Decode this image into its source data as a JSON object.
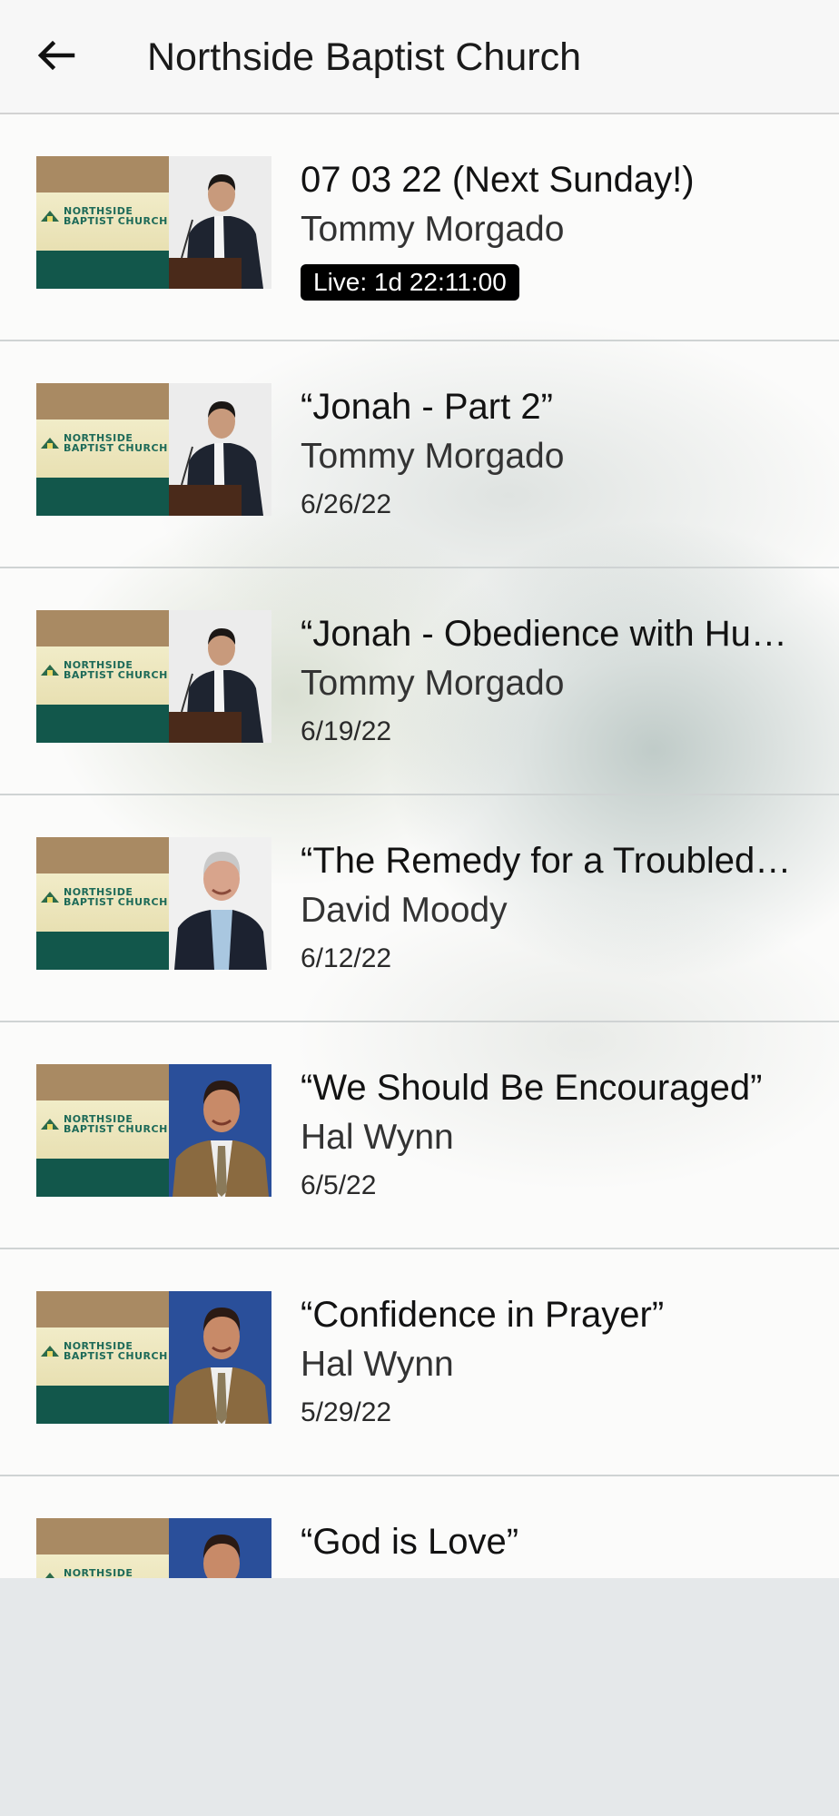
{
  "header": {
    "back_icon": "arrow-left-icon",
    "title": "Northside Baptist Church"
  },
  "thumbnail_logo": {
    "line1": "NORTHSIDE",
    "line2": "BAPTIST CHURCH"
  },
  "colors": {
    "header_bg": "#f7f7f7",
    "logo_tan": "#a98a63",
    "logo_cream": "#f1ecc8",
    "logo_green": "#12574b",
    "badge_bg": "#000000",
    "list_bg": "#fbfbfa",
    "footer_bg": "#e5e8ea"
  },
  "sermons": [
    {
      "title": "07 03 22 (Next Sunday!)",
      "speaker": "Tommy Morgado",
      "live_badge": "Live: 1d 22:11:00",
      "photo": "tommy"
    },
    {
      "title": "“Jonah - Part 2”",
      "speaker": "Tommy Morgado",
      "date": "6/26/22",
      "photo": "tommy"
    },
    {
      "title": "“Jonah - Obedience with Hu…",
      "speaker": "Tommy Morgado",
      "date": "6/19/22",
      "photo": "tommy"
    },
    {
      "title": "“The Remedy for a Troubled…",
      "speaker": "David Moody",
      "date": "6/12/22",
      "photo": "david"
    },
    {
      "title": "“We Should Be Encouraged”",
      "speaker": "Hal Wynn",
      "date": "6/5/22",
      "photo": "hal"
    },
    {
      "title": "“Confidence in Prayer”",
      "speaker": "Hal Wynn",
      "date": "5/29/22",
      "photo": "hal"
    },
    {
      "title": "“God is Love”",
      "photo": "hal"
    }
  ]
}
